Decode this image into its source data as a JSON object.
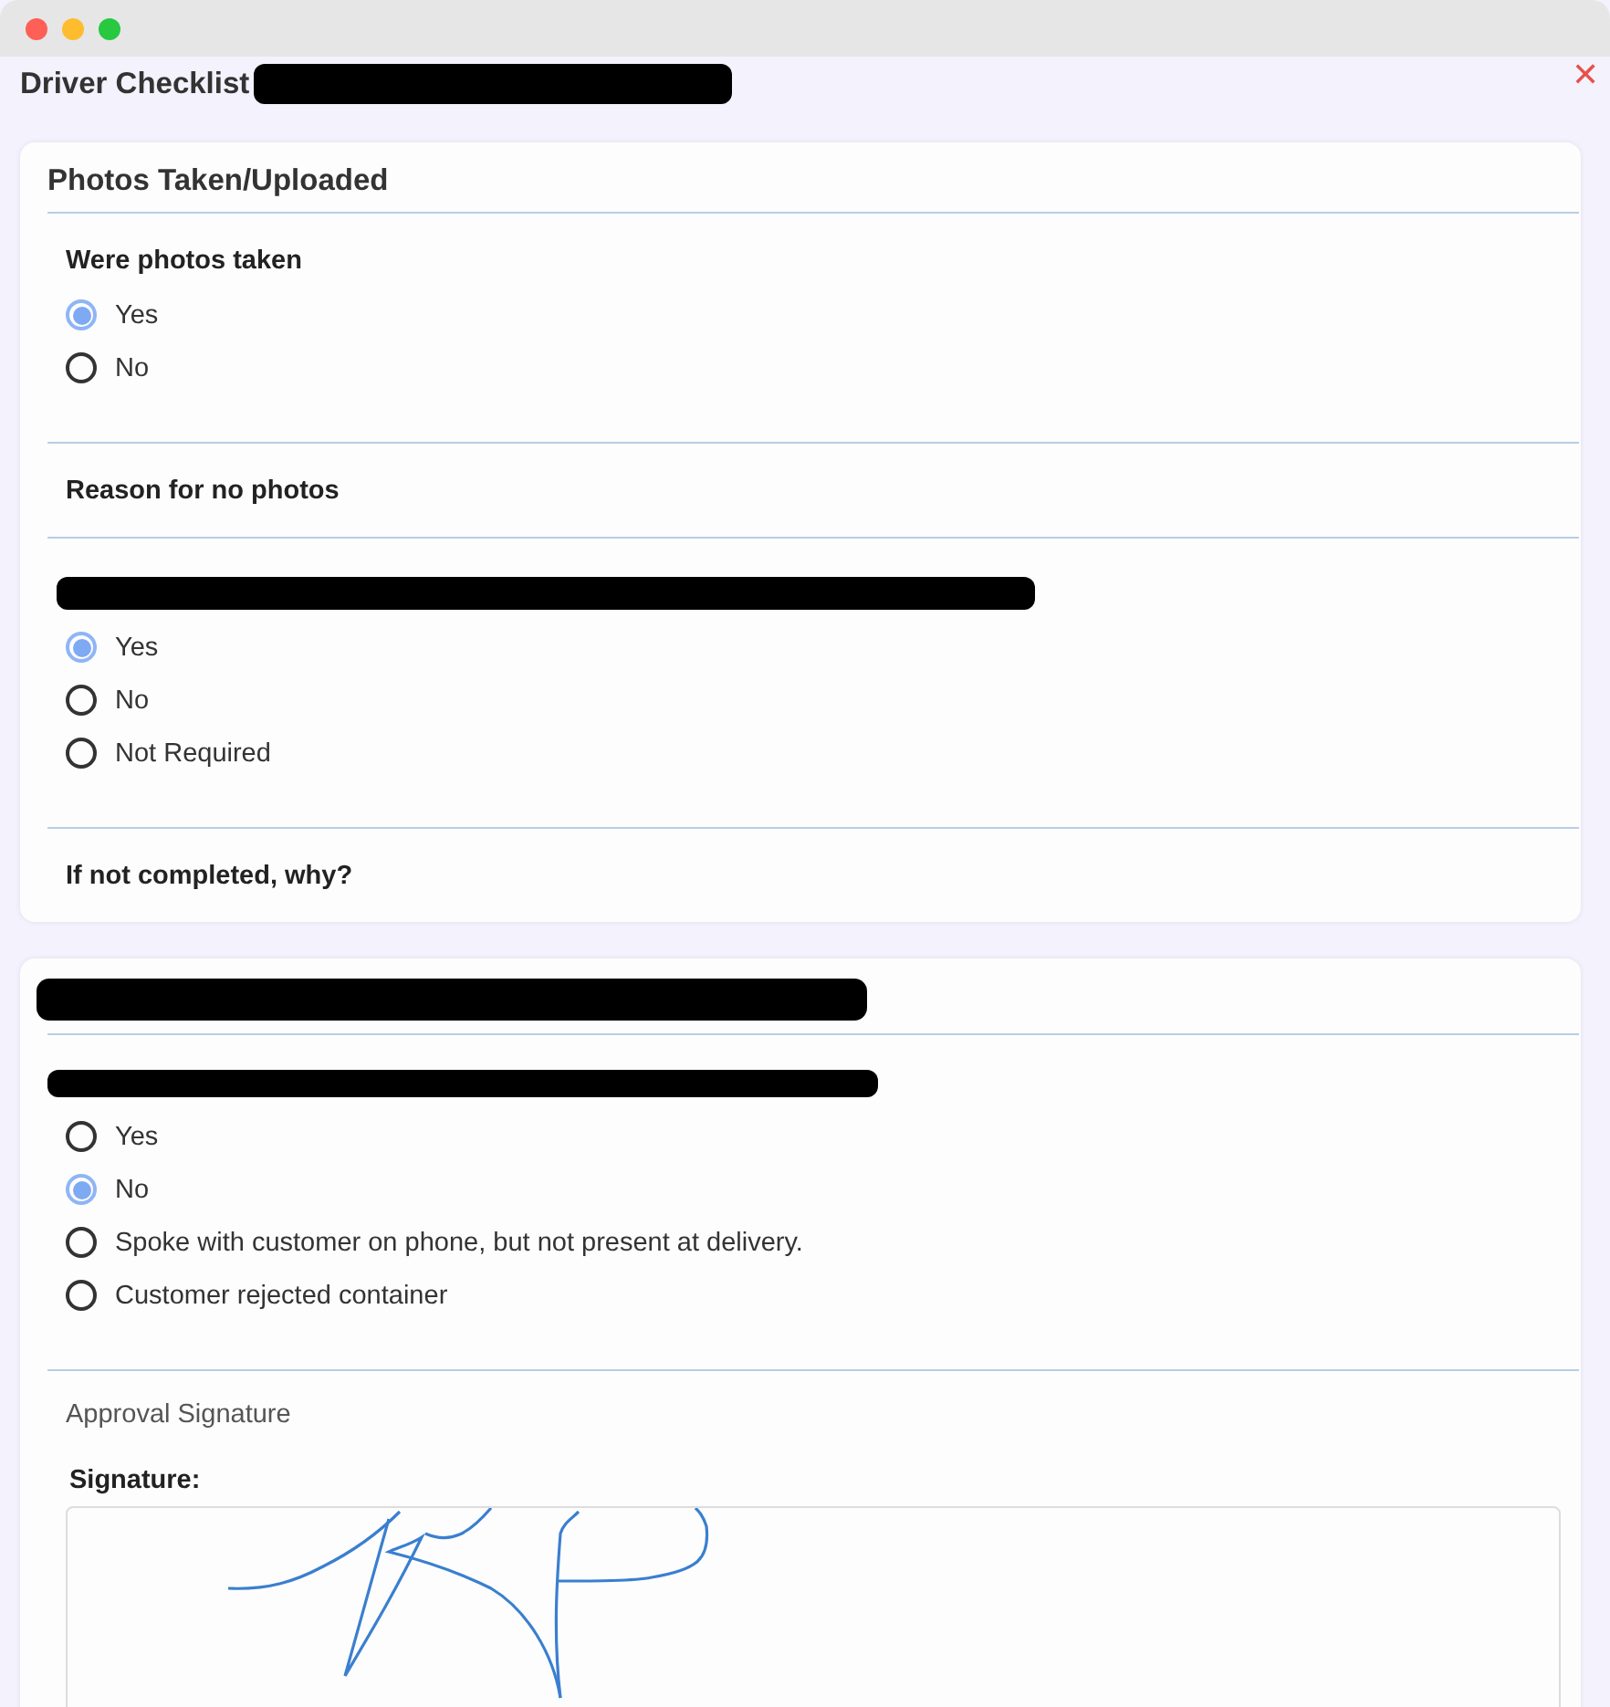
{
  "window": {
    "title": "Driver Checklist",
    "title_redacted": true,
    "close": "✕"
  },
  "sections": [
    {
      "heading": "Photos Taken/Uploaded",
      "heading_redacted": false,
      "items": [
        {
          "kind": "question",
          "label": "Were photos taken",
          "redacted": false,
          "options": [
            {
              "label": "Yes",
              "selected": true
            },
            {
              "label": "No",
              "selected": false
            }
          ]
        },
        {
          "kind": "question",
          "label": "Reason for no photos",
          "redacted": false
        },
        {
          "kind": "question",
          "redacted": true,
          "options": [
            {
              "label": "Yes",
              "selected": true
            },
            {
              "label": "No",
              "selected": false
            },
            {
              "label": "Not Required",
              "selected": false
            }
          ]
        },
        {
          "kind": "question",
          "label": "If not completed, why?",
          "redacted": false
        }
      ]
    },
    {
      "heading_redacted": true,
      "items": [
        {
          "kind": "question",
          "redacted": true,
          "options": [
            {
              "label": "Yes",
              "selected": false
            },
            {
              "label": "No",
              "selected": true
            },
            {
              "label": "Spoke with customer on phone, but not present at delivery.",
              "selected": false
            },
            {
              "label": "Customer rejected container",
              "selected": false
            }
          ]
        },
        {
          "kind": "signature",
          "label": "Approval Signature",
          "field_label": "Signature:"
        }
      ]
    }
  ]
}
